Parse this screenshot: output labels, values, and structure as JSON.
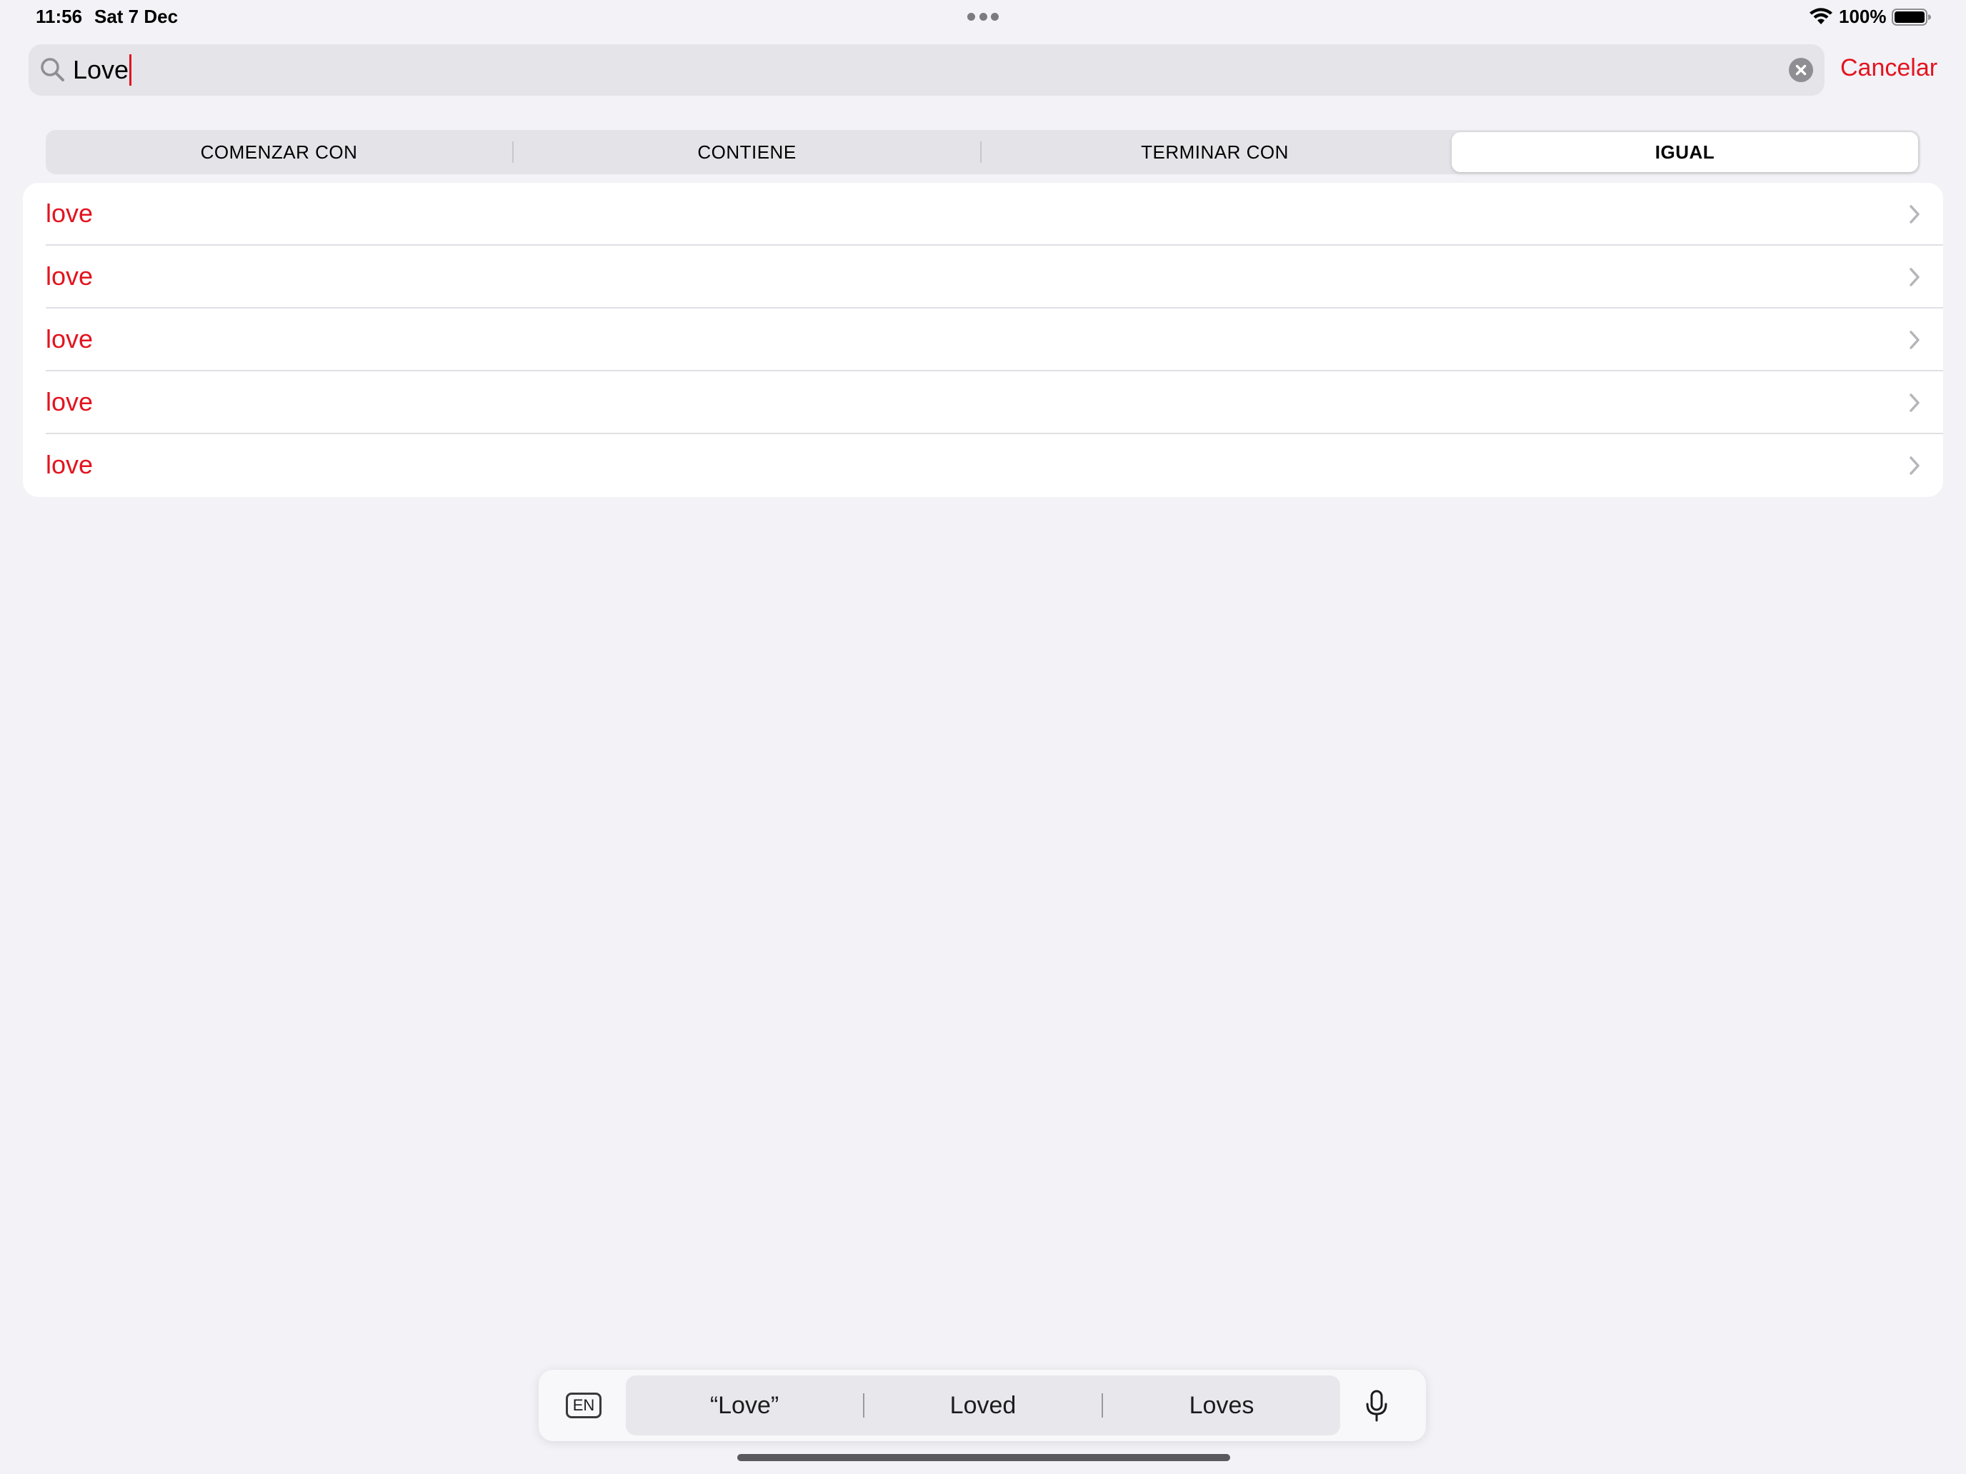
{
  "status_bar": {
    "time": "11:56",
    "date": "Sat 7 Dec",
    "battery_percent": "100%",
    "icons": [
      "wifi-icon",
      "battery-icon"
    ]
  },
  "search": {
    "value": "Love",
    "cancel_label": "Cancelar",
    "icons": [
      "search-icon",
      "clear-icon"
    ]
  },
  "segments": [
    {
      "label": "COMENZAR CON",
      "selected": false
    },
    {
      "label": "CONTIENE",
      "selected": false
    },
    {
      "label": "TERMINAR CON",
      "selected": false
    },
    {
      "label": "IGUAL",
      "selected": true
    }
  ],
  "results": [
    {
      "label": "love"
    },
    {
      "label": "love"
    },
    {
      "label": "love"
    },
    {
      "label": "love"
    },
    {
      "label": "love"
    }
  ],
  "keyboard_bar": {
    "language": "EN",
    "predictions": [
      "“Love”",
      "Loved",
      "Loves"
    ]
  },
  "colors": {
    "accent": "#e3141f",
    "background": "#f2f2f7",
    "card": "#ffffff"
  }
}
